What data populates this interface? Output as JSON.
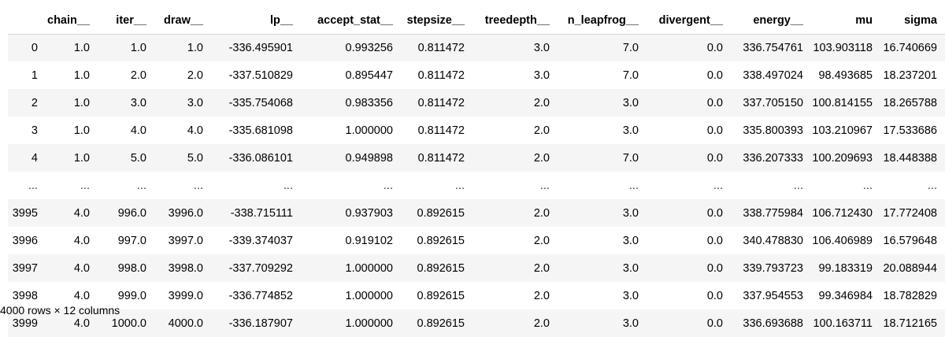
{
  "table": {
    "columns": [
      "",
      "chain__",
      "iter__",
      "draw__",
      "lp__",
      "accept_stat__",
      "stepsize__",
      "treedepth__",
      "n_leapfrog__",
      "divergent__",
      "energy__",
      "mu",
      "sigma"
    ],
    "rows": [
      [
        "0",
        "1.0",
        "1.0",
        "1.0",
        "-336.495901",
        "0.993256",
        "0.811472",
        "3.0",
        "7.0",
        "0.0",
        "336.754761",
        "103.903118",
        "16.740669"
      ],
      [
        "1",
        "1.0",
        "2.0",
        "2.0",
        "-337.510829",
        "0.895447",
        "0.811472",
        "3.0",
        "7.0",
        "0.0",
        "338.497024",
        "98.493685",
        "18.237201"
      ],
      [
        "2",
        "1.0",
        "3.0",
        "3.0",
        "-335.754068",
        "0.983356",
        "0.811472",
        "2.0",
        "3.0",
        "0.0",
        "337.705150",
        "100.814155",
        "18.265788"
      ],
      [
        "3",
        "1.0",
        "4.0",
        "4.0",
        "-335.681098",
        "1.000000",
        "0.811472",
        "2.0",
        "3.0",
        "0.0",
        "335.800393",
        "103.210967",
        "17.533686"
      ],
      [
        "4",
        "1.0",
        "5.0",
        "5.0",
        "-336.086101",
        "0.949898",
        "0.811472",
        "2.0",
        "7.0",
        "0.0",
        "336.207333",
        "100.209693",
        "18.448388"
      ],
      [
        "...",
        "...",
        "...",
        "...",
        "...",
        "...",
        "...",
        "...",
        "...",
        "...",
        "...",
        "...",
        "..."
      ],
      [
        "3995",
        "4.0",
        "996.0",
        "3996.0",
        "-338.715111",
        "0.937903",
        "0.892615",
        "2.0",
        "3.0",
        "0.0",
        "338.775984",
        "106.712430",
        "17.772408"
      ],
      [
        "3996",
        "4.0",
        "997.0",
        "3997.0",
        "-339.374037",
        "0.919102",
        "0.892615",
        "2.0",
        "3.0",
        "0.0",
        "340.478830",
        "106.406989",
        "16.579648"
      ],
      [
        "3997",
        "4.0",
        "998.0",
        "3998.0",
        "-337.709292",
        "1.000000",
        "0.892615",
        "2.0",
        "3.0",
        "0.0",
        "339.793723",
        "99.183319",
        "20.088944"
      ],
      [
        "3998",
        "4.0",
        "999.0",
        "3999.0",
        "-336.774852",
        "1.000000",
        "0.892615",
        "2.0",
        "3.0",
        "0.0",
        "337.954553",
        "99.346984",
        "18.782829"
      ],
      [
        "3999",
        "4.0",
        "1000.0",
        "4000.0",
        "-336.187907",
        "1.000000",
        "0.892615",
        "2.0",
        "3.0",
        "0.0",
        "336.693688",
        "100.163711",
        "18.712165"
      ]
    ]
  },
  "shape_text": "4000 rows × 12 columns"
}
